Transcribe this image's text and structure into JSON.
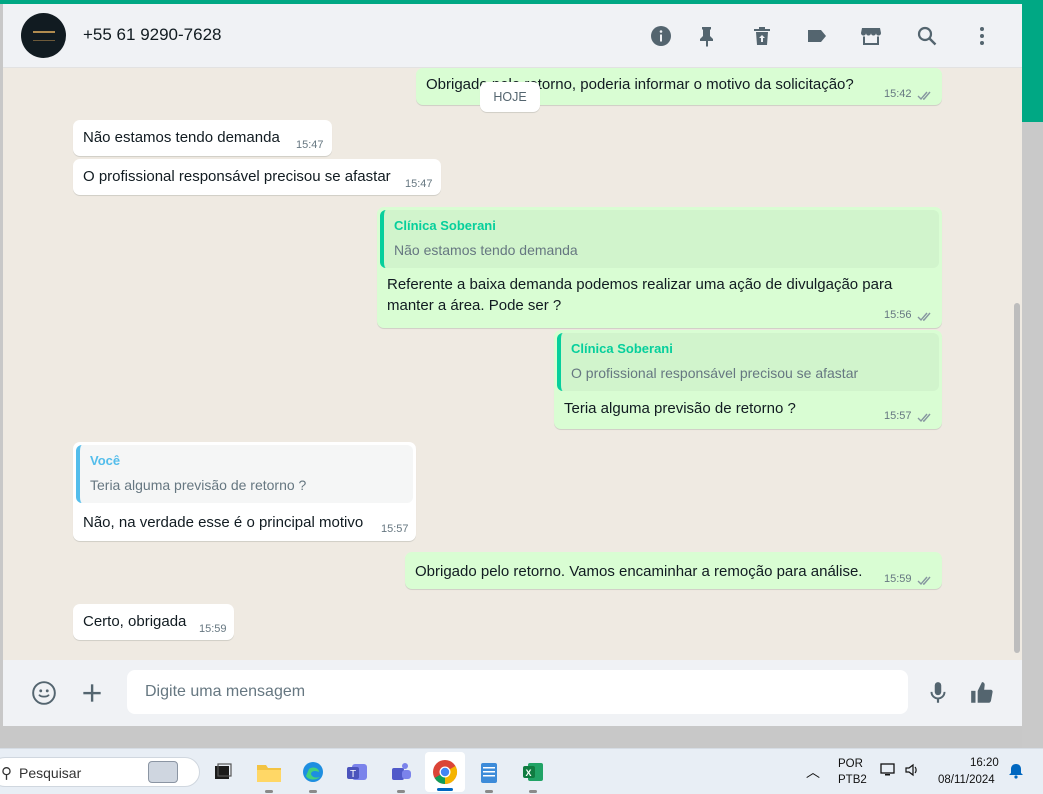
{
  "header": {
    "contact_name": "+55 61 9290-7628",
    "avatar_icon": "clinic-logo",
    "icons": [
      "info-icon",
      "pin-icon",
      "delete-icon",
      "label-icon",
      "store-icon",
      "search-icon",
      "more-vert-icon"
    ]
  },
  "chat": {
    "date_chip": "HOJE",
    "messages": [
      {
        "dir": "out",
        "text": "Obrigado pelo retorno, poderia informar o motivo da solicitação?",
        "time": "15:42"
      },
      {
        "dir": "in",
        "text": "Não estamos tendo demanda",
        "time": "15:47"
      },
      {
        "dir": "in",
        "text": "O profissional responsável precisou se afastar",
        "time": "15:47"
      },
      {
        "dir": "out",
        "quote_author": "Clínica Soberani",
        "quote_text": "Não estamos tendo demanda",
        "text_line1": "Referente a baixa demanda podemos realizar uma ação de divulgação para",
        "text_line2": "manter a área. Pode ser ?",
        "time": "15:56"
      },
      {
        "dir": "out",
        "quote_author": "Clínica Soberani",
        "quote_text": "O profissional responsável precisou se afastar",
        "text": "Teria alguma previsão de retorno ?",
        "time": "15:57"
      },
      {
        "dir": "in",
        "quote_author": "Você",
        "quote_text": "Teria alguma previsão de retorno ?",
        "text": "Não, na verdade esse é o principal motivo",
        "time": "15:57"
      },
      {
        "dir": "out",
        "text": "Obrigado pelo retorno. Vamos encaminhar a remoção para análise.",
        "time": "15:59"
      },
      {
        "dir": "in",
        "text": "Certo, obrigada",
        "time": "15:59"
      }
    ]
  },
  "footer": {
    "input_placeholder": "Digite uma mensagem",
    "icons": [
      "emoji-icon",
      "plus-icon",
      "mic-icon",
      "thumbs-up-icon"
    ]
  },
  "taskbar": {
    "search_placeholder": "Pesquisar",
    "apps": [
      "task-view",
      "file-explorer",
      "edge",
      "teams-classic",
      "teams",
      "chrome",
      "notepad",
      "excel"
    ],
    "active_app": "chrome",
    "language_line1": "POR",
    "language_line2": "PTB2",
    "time": "16:20",
    "date": "08/11/2024"
  },
  "colors": {
    "accent": "#00a884",
    "outgoing_bubble": "#d9fdd3",
    "incoming_bubble": "#ffffff",
    "chat_background": "#efeae2",
    "quote_author_out": "#06cf9c",
    "quote_author_in": "#53bdeb"
  }
}
